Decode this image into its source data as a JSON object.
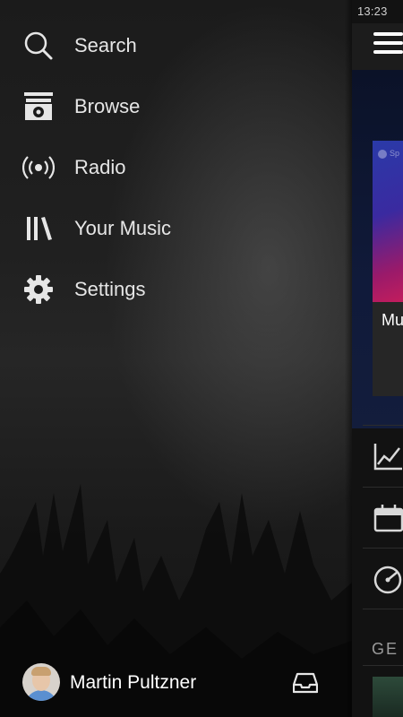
{
  "status_bar": {
    "time": "13:23"
  },
  "drawer": {
    "menu": [
      {
        "label": "Search",
        "icon": "search-icon"
      },
      {
        "label": "Browse",
        "icon": "browse-icon"
      },
      {
        "label": "Radio",
        "icon": "radio-icon"
      },
      {
        "label": "Your Music",
        "icon": "your-music-icon"
      },
      {
        "label": "Settings",
        "icon": "gear-icon"
      }
    ],
    "profile": {
      "name": "Martin Pultzner",
      "avatar": "avatar-photo"
    },
    "inbox_icon": "inbox-icon"
  },
  "main": {
    "menu_icon": "hamburger-icon",
    "card": {
      "title": "Mu",
      "badge_text": "Sp"
    },
    "rows": [
      {
        "icon": "chart-icon"
      },
      {
        "icon": "calendar-icon"
      },
      {
        "icon": "discover-icon"
      }
    ],
    "section_label": "GE"
  },
  "colors": {
    "background": "#121212",
    "drawer_text": "#e6e6e6",
    "muted": "#9a9a9a"
  }
}
